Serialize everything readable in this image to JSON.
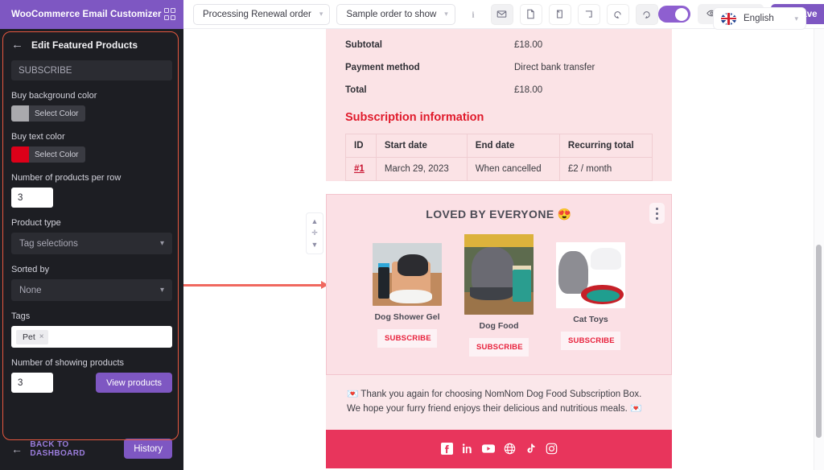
{
  "app": {
    "brand_title": "WooCommerce Email Customizer",
    "grid_icon": "grid-icon"
  },
  "toolbar": {
    "email_type": "Processing Renewal order",
    "sample_order": "Sample order to show",
    "icons": [
      {
        "name": "info-icon",
        "glyph": "i"
      },
      {
        "name": "envelope-icon",
        "glyph": "✉"
      },
      {
        "name": "page-icon",
        "glyph": "□"
      },
      {
        "name": "mobile-preview-icon",
        "glyph": "□"
      },
      {
        "name": "desktop-preview-icon",
        "glyph": "□"
      },
      {
        "name": "undo-icon",
        "glyph": "↺"
      },
      {
        "name": "redo-icon",
        "glyph": "↻"
      }
    ],
    "toggle_on": true,
    "preview_label": "Preview",
    "save_label": "Save",
    "preview_icon": "eye-icon",
    "save_icon": "floppy-disk-icon"
  },
  "language": {
    "label": "English",
    "flag": "uk-flag-icon",
    "chevron": "∨"
  },
  "sidebar": {
    "back_arrow": "←",
    "panel_title": "Edit Featured Products",
    "button_text_value": "SUBSCRIBE",
    "buy_bg_label": "Buy background color",
    "buy_bg_button": "Select Color",
    "buy_bg_color": "#a9a9ad",
    "buy_text_label": "Buy text color",
    "buy_text_button": "Select Color",
    "buy_text_color": "#dd0019",
    "products_per_row_label": "Number of products per row",
    "products_per_row_value": "3",
    "product_type_label": "Product type",
    "product_type_value": "Tag selections",
    "sorted_by_label": "Sorted by",
    "sorted_by_value": "None",
    "tags_label": "Tags",
    "tag_chip": "Pet",
    "tag_chip_remove": "×",
    "showing_products_label": "Number of showing products",
    "showing_products_value": "3",
    "view_products_label": "View products",
    "back_to_dashboard": "BACK TO DASHBOARD",
    "history_label": "History",
    "chevron": "∨",
    "highlight_color": "#e8583f"
  },
  "collapse_tab": {
    "name": "collapse-sidebar-tab",
    "glyph": "◀"
  },
  "block_rail": {
    "move_up": "▲",
    "move_block": "✛",
    "move_down": "▼"
  },
  "email": {
    "totals": [
      {
        "key": "Subtotal",
        "value": "£18.00"
      },
      {
        "key": "Payment method",
        "value": "Direct bank transfer"
      },
      {
        "key": "Total",
        "value": "£18.00"
      }
    ],
    "subscription_title": "Subscription information",
    "subscription_table": {
      "headers": [
        "ID",
        "Start date",
        "End date",
        "Recurring total"
      ],
      "rows": [
        [
          "#1",
          "March 29, 2023",
          "When cancelled",
          "£2 / month"
        ]
      ]
    },
    "featured": {
      "title": "LOVED BY EVERYONE 😍",
      "menu_icon": "kebab-menu-icon",
      "products": [
        {
          "name": "Dog Shower Gel",
          "button": "SUBSCRIBE",
          "image": "dog-shower-gel-photo"
        },
        {
          "name": "Dog Food",
          "button": "SUBSCRIBE",
          "image": "dog-food-photo"
        },
        {
          "name": "Cat Toys",
          "button": "SUBSCRIBE",
          "image": "cat-toys-photo"
        }
      ]
    },
    "thank_you": "💌 Thank you again for choosing NomNom Dog Food Subscription Box. We hope your furry friend enjoys their delicious and nutritious meals. 💌",
    "social": [
      {
        "name": "facebook-icon",
        "glyph": "f"
      },
      {
        "name": "linkedin-icon",
        "glyph": "in"
      },
      {
        "name": "youtube-icon",
        "glyph": "▶"
      },
      {
        "name": "website-globe-icon",
        "glyph": "⊕"
      },
      {
        "name": "tiktok-icon",
        "glyph": "♪"
      },
      {
        "name": "instagram-icon",
        "glyph": "▣"
      }
    ],
    "footer_bg": "#e8355c"
  },
  "annotation": {
    "name": "red-arrow-annotation",
    "color": "#f0685f"
  }
}
